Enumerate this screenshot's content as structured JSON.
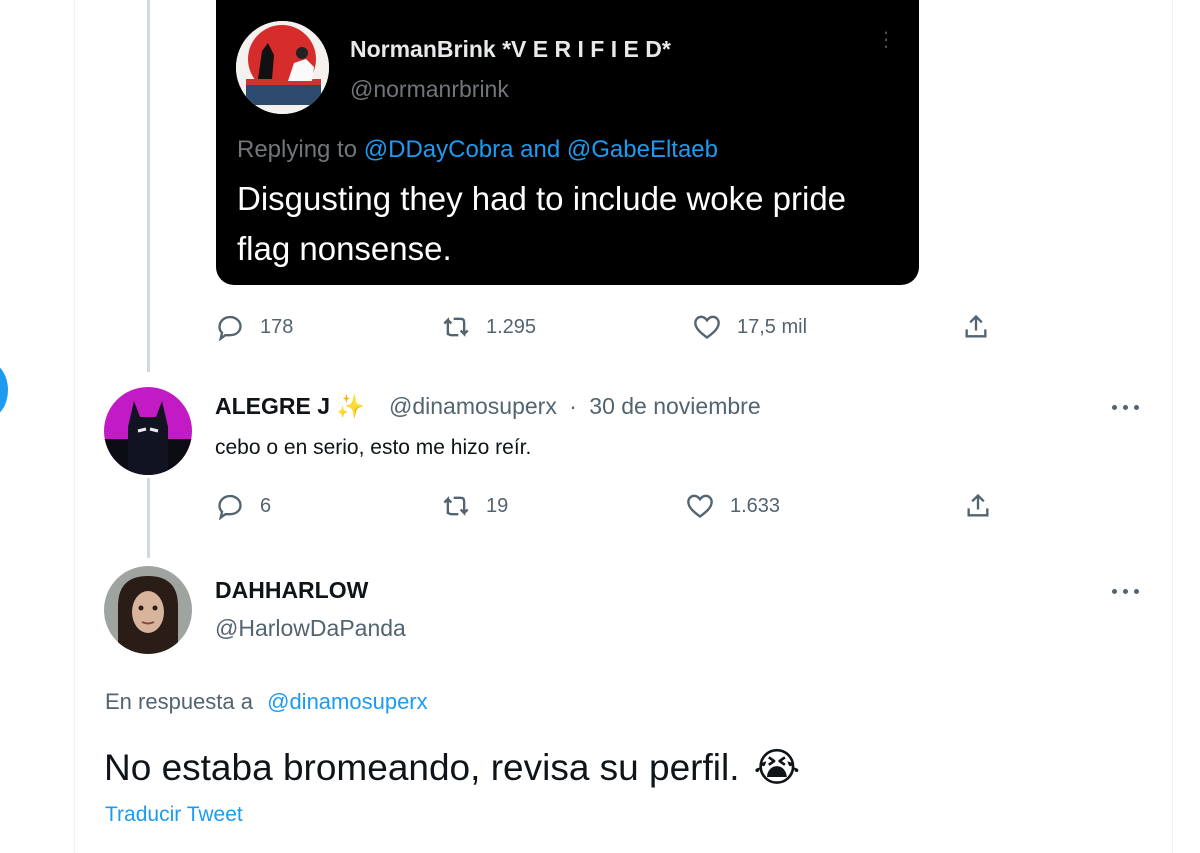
{
  "quoted_tweet": {
    "author_name": "NormanBrink *V E R I F I E D*",
    "author_handle": "@normanrbrink",
    "more_label": "⋮",
    "replying_prefix": "Replying to",
    "replying_mentions": "@DDayCobra and @GabeEltaeb",
    "text": "Disgusting they had to include woke pride flag nonsense."
  },
  "tweet1_actions": {
    "replies": "178",
    "retweets": "1.295",
    "likes": "17,5 mil"
  },
  "tweet2": {
    "author_name": "ALEGRE J",
    "sparkle": "✨",
    "author_handle": "@dinamosuperx",
    "separator": "·",
    "date": "30 de noviembre",
    "text": "cebo o en serio, esto me hizo reír.",
    "actions": {
      "replies": "6",
      "retweets": "19",
      "likes": "1.633"
    }
  },
  "tweet3": {
    "author_name": "DAHHARLOW",
    "author_handle": "@HarlowDaPanda",
    "replying_prefix": "En respuesta a",
    "replying_mention": "@dinamosuperx",
    "text": "No estaba bromeando, revisa su perfil.",
    "emoji": "😭",
    "translate_label": "Traducir Tweet"
  },
  "colors": {
    "accent": "#1d9bf0",
    "secondary_text": "#536471",
    "dark_card": "#000000"
  },
  "icons": [
    "reply-icon",
    "retweet-icon",
    "like-icon",
    "share-icon",
    "more-icon"
  ]
}
